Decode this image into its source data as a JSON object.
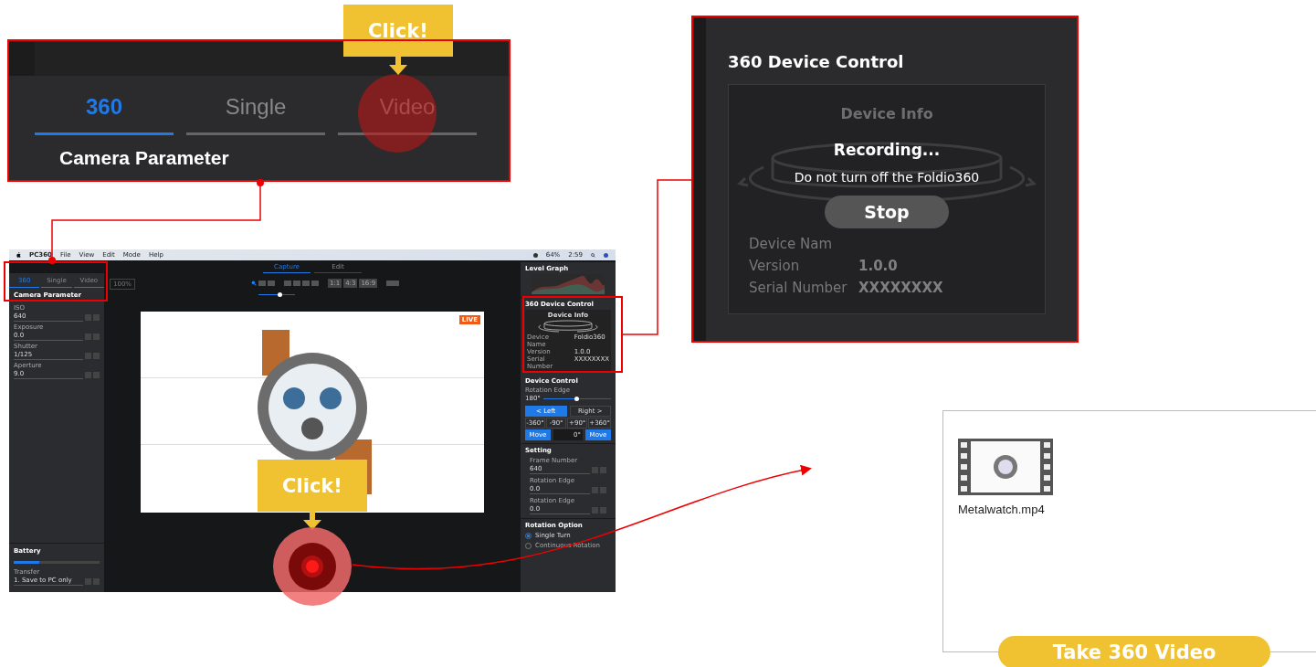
{
  "mode_callout": {
    "tabs": [
      {
        "label": "360",
        "selected": true
      },
      {
        "label": "Single",
        "selected": false
      },
      {
        "label": "Video",
        "selected": false
      }
    ],
    "heading": "Camera Parameter",
    "click_label": "Click!"
  },
  "device_callout": {
    "title": "360 Device Control",
    "info_title": "Device Info",
    "status": "Recording...",
    "warning": "Do not turn off the Foldio360",
    "stop_button": "Stop",
    "fields": [
      {
        "label": "Device Nam"
      },
      {
        "label": "Version",
        "value": "1.0.0"
      },
      {
        "label": "Serial Number",
        "value": "XXXXXXXX"
      }
    ]
  },
  "app": {
    "menu_bar": {
      "app_name": "PC360",
      "menus": [
        "File",
        "View",
        "Edit",
        "Mode",
        "Help"
      ],
      "battery": "64%",
      "time": "2:59"
    },
    "left_panel": {
      "tabs": [
        {
          "label": "360",
          "selected": true
        },
        {
          "label": "Single",
          "selected": false
        },
        {
          "label": "Video",
          "selected": false
        }
      ],
      "heading": "Camera Parameter",
      "params": [
        {
          "label": "ISO",
          "value": "640"
        },
        {
          "label": "Exposure",
          "value": "0.0"
        },
        {
          "label": "Shutter",
          "value": "1/125"
        },
        {
          "label": "Aperture",
          "value": "9.0"
        }
      ],
      "battery": {
        "title": "Battery",
        "level": 0.3
      },
      "transfer": {
        "label": "Transfer",
        "value": "1. Save to PC only"
      }
    },
    "center": {
      "tabs": [
        {
          "label": "Capture",
          "selected": true
        },
        {
          "label": "Edit",
          "selected": false
        }
      ],
      "zoom": "100%",
      "zoom_slider": {
        "level": 0.6
      },
      "ratios": [
        "1:1",
        "4:3",
        "16:9"
      ],
      "live_badge": "LIVE"
    },
    "right_panel": {
      "level_graph": "Level Graph",
      "device_control_title": "360 Device Control",
      "device_info": {
        "title": "Device Info",
        "fields": [
          {
            "label": "Device Name",
            "value": "Foldio360"
          },
          {
            "label": "Version",
            "value": "1.0.0"
          },
          {
            "label": "Serial Number",
            "value": "XXXXXXXX"
          }
        ]
      },
      "device_control": {
        "title": "Device Control",
        "slider_label": "Rotation Edge",
        "reading": "180°",
        "level": 0.5,
        "directions": [
          {
            "label": "< Left",
            "selected": true
          },
          {
            "label": "Right >",
            "selected": false
          }
        ],
        "steps": [
          "-360°",
          "-90°",
          "+90°",
          "+360°"
        ],
        "move_left": "Move",
        "angle": "0°",
        "move_right": "Move"
      },
      "setting": {
        "title": "Setting",
        "params": [
          {
            "label": "Frame Number",
            "value": "640"
          },
          {
            "label": "Rotation Edge",
            "value": "0.0"
          },
          {
            "label": "Rotation Edge",
            "value": "0.0"
          }
        ]
      },
      "rotation_option": {
        "title": "Rotation Option",
        "options": [
          {
            "label": "Single Turn",
            "selected": true
          },
          {
            "label": "Continuous Rotation",
            "selected": false
          }
        ]
      }
    }
  },
  "record_click": {
    "label": "Click!"
  },
  "output": {
    "file_name": "Metalwatch.mp4",
    "caption": "Take 360 Video"
  }
}
